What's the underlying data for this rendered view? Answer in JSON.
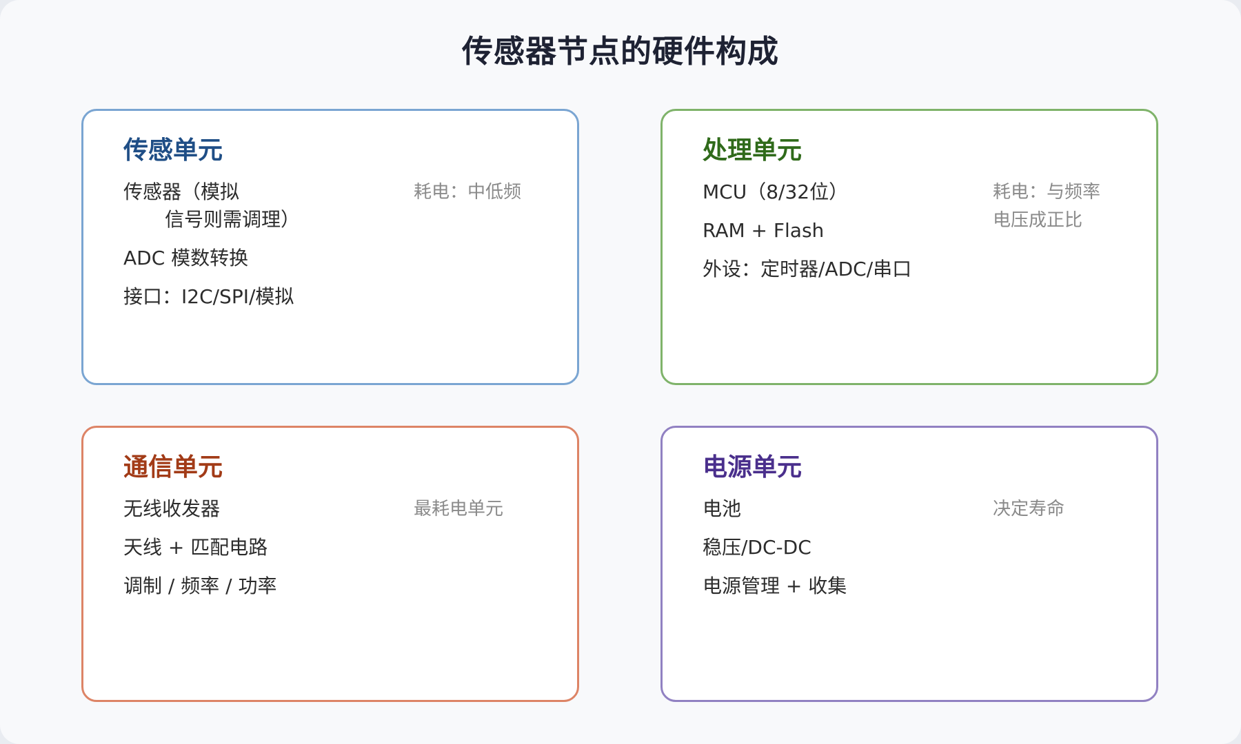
{
  "title": "传感器节点的硬件构成",
  "cards": {
    "sense": {
      "title": "传感单元",
      "items": [
        "传感器（模拟",
        "信号则需调理）",
        "ADC 模数转换",
        "接口：I2C/SPI/模拟"
      ],
      "note": "耗电：中低频"
    },
    "proc": {
      "title": "处理单元",
      "items": [
        "MCU（8/32位）",
        "RAM + Flash",
        "外设：定时器/ADC/串口"
      ],
      "note_lines": [
        "耗电：与频率",
        "电压成正比"
      ]
    },
    "comm": {
      "title": "通信单元",
      "items": [
        "无线收发器",
        "天线 + 匹配电路",
        "调制 / 频率 / 功率"
      ],
      "note": "最耗电单元"
    },
    "power": {
      "title": "电源单元",
      "items": [
        "电池",
        "稳压/DC-DC",
        "电源管理 + 收集"
      ],
      "note": "决定寿命"
    }
  },
  "colors": {
    "sense_border": "#7aa5d2",
    "sense_title": "#1f4e86",
    "proc_border": "#7fb36a",
    "proc_title": "#2f6a1a",
    "comm_border": "#dd8466",
    "comm_title": "#a23b17",
    "power_border": "#9181c2",
    "power_title": "#4a2f8c"
  }
}
